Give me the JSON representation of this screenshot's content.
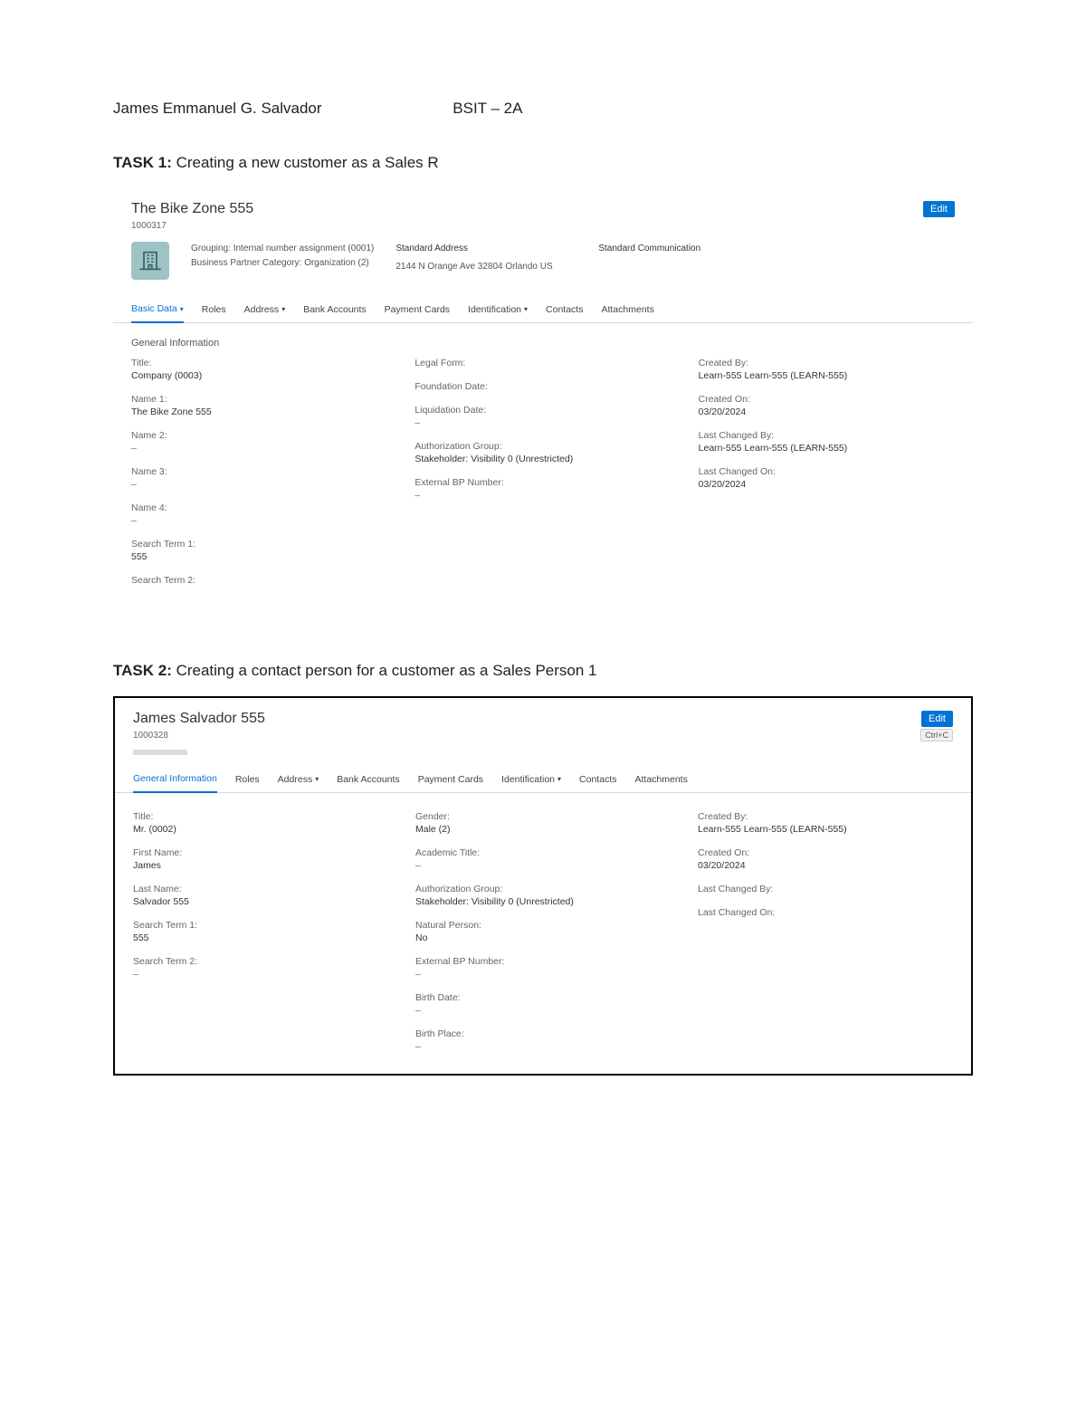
{
  "doc": {
    "name": "James Emmanuel G. Salvador",
    "course": "BSIT – 2A"
  },
  "task1_heading_prefix": "TASK 1: ",
  "task1_heading": "Creating a new customer as a Sales R",
  "task2_heading_prefix": "TASK 2: ",
  "task2_heading": "Creating a contact person for a customer as a Sales Person 1",
  "common": {
    "edit": "Edit",
    "ctrlc": "Ctrl+C"
  },
  "s1": {
    "title": "The Bike Zone 555",
    "id": "1000317",
    "overview": {
      "grouping_label": "Grouping:",
      "grouping_value": "Internal number assignment (0001)",
      "bpcat_label": "Business Partner Category:",
      "bpcat_value": "Organization (2)",
      "std_addr_label": "Standard Address",
      "std_addr_value": "2144 N Orange Ave 32804 Orlando US",
      "std_comm_label": "Standard Communication"
    },
    "tabs": {
      "basic": "Basic Data",
      "roles": "Roles",
      "address": "Address",
      "bank": "Bank Accounts",
      "payment": "Payment Cards",
      "ident": "Identification",
      "contacts": "Contacts",
      "attach": "Attachments"
    },
    "section": "General Information",
    "left": {
      "title_l": "Title:",
      "title_v": "Company (0003)",
      "name1_l": "Name 1:",
      "name1_v": "The Bike Zone 555",
      "name2_l": "Name 2:",
      "name2_v": "–",
      "name3_l": "Name 3:",
      "name3_v": "–",
      "name4_l": "Name 4:",
      "name4_v": "–",
      "st1_l": "Search Term 1:",
      "st1_v": "555",
      "st2_l": "Search Term 2:"
    },
    "mid": {
      "legal_l": "Legal Form:",
      "found_l": "Foundation Date:",
      "liq_l": "Liquidation Date:",
      "liq_v": "–",
      "auth_l": "Authorization Group:",
      "auth_v": "Stakeholder: Visibility 0 (Unrestricted)",
      "ext_l": "External BP Number:",
      "ext_v": "–"
    },
    "right": {
      "cby_l": "Created By:",
      "cby_v": "Learn-555 Learn-555 (LEARN-555)",
      "con_l": "Created On:",
      "con_v": "03/20/2024",
      "lcb_l": "Last Changed By:",
      "lcb_v": "Learn-555 Learn-555 (LEARN-555)",
      "lco_l": "Last Changed On:",
      "lco_v": "03/20/2024"
    }
  },
  "s2": {
    "title": "James Salvador 555",
    "id": "1000328",
    "tabs": {
      "gen": "General Information",
      "roles": "Roles",
      "address": "Address",
      "bank": "Bank Accounts",
      "payment": "Payment Cards",
      "ident": "Identification",
      "contacts": "Contacts",
      "attach": "Attachments"
    },
    "left": {
      "title_l": "Title:",
      "title_v": "Mr. (0002)",
      "fn_l": "First Name:",
      "fn_v": "James",
      "ln_l": "Last Name:",
      "ln_v": "Salvador 555",
      "st1_l": "Search Term 1:",
      "st1_v": "555",
      "st2_l": "Search Term 2:",
      "st2_v": "–"
    },
    "mid": {
      "gender_l": "Gender:",
      "gender_v": "Male (2)",
      "acad_l": "Academic Title:",
      "acad_v": "–",
      "auth_l": "Authorization Group:",
      "auth_v": "Stakeholder: Visibility 0 (Unrestricted)",
      "nat_l": "Natural Person:",
      "nat_v": "No",
      "ext_l": "External BP Number:",
      "ext_v": "–",
      "bd_l": "Birth Date:",
      "bd_v": "–",
      "bp_l": "Birth Place:",
      "bp_v": "–"
    },
    "right": {
      "cby_l": "Created By:",
      "cby_v": "Learn-555 Learn-555 (LEARN-555)",
      "con_l": "Created On:",
      "con_v": "03/20/2024",
      "lcb_l": "Last Changed By:",
      "lco_l": "Last Changed On:"
    }
  }
}
